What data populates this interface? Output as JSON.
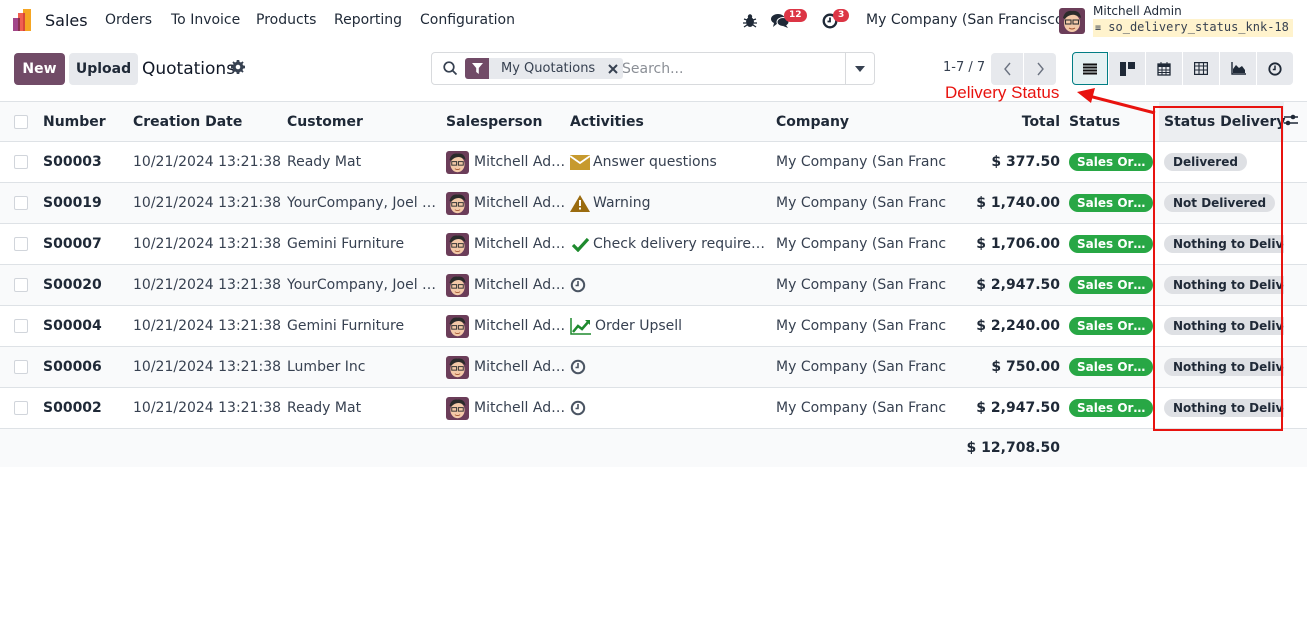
{
  "navbar": {
    "app_name": "Sales",
    "menu": [
      "Orders",
      "To Invoice",
      "Products",
      "Reporting",
      "Configuration"
    ],
    "messages_count": "12",
    "activities_count": "3",
    "company": "My Company (San Francisco)",
    "user_name": "Mitchell Admin",
    "database": "so_delivery_status_knk-18"
  },
  "control_panel": {
    "new_label": "New",
    "upload_label": "Upload",
    "title": "Quotations",
    "search": {
      "facet_label": "My Quotations",
      "placeholder": "Search..."
    },
    "pager": "1-7 / 7",
    "views": [
      "list",
      "kanban",
      "calendar",
      "pivot",
      "graph",
      "activity"
    ],
    "active_view": "list"
  },
  "annotation": {
    "label": "Delivery Status",
    "color": "#e8130f"
  },
  "table": {
    "columns": [
      "Number",
      "Creation Date",
      "Customer",
      "Salesperson",
      "Activities",
      "Company",
      "Total",
      "Status",
      "Status Delivery"
    ],
    "rows": [
      {
        "number": "S00003",
        "date": "10/21/2024 13:21:38",
        "customer": "Ready Mat",
        "salesperson": "Mitchell Ad…",
        "activity_icon": "envelope-icon",
        "activity": "Answer questions",
        "company": "My Company (San Franci…",
        "total": "$ 377.50",
        "status": "Sales Or…",
        "delivery": "Delivered"
      },
      {
        "number": "S00019",
        "date": "10/21/2024 13:21:38",
        "customer": "YourCompany, Joel …",
        "salesperson": "Mitchell Ad…",
        "activity_icon": "warning-icon",
        "activity": "Warning",
        "company": "My Company (San Franci…",
        "total": "$ 1,740.00",
        "status": "Sales Or…",
        "delivery": "Not Delivered"
      },
      {
        "number": "S00007",
        "date": "10/21/2024 13:21:38",
        "customer": "Gemini Furniture",
        "salesperson": "Mitchell Ad…",
        "activity_icon": "check-icon",
        "activity": "Check delivery requirem…",
        "company": "My Company (San Franci…",
        "total": "$ 1,706.00",
        "status": "Sales Or…",
        "delivery": "Nothing to Deliver"
      },
      {
        "number": "S00020",
        "date": "10/21/2024 13:21:38",
        "customer": "YourCompany, Joel …",
        "salesperson": "Mitchell Ad…",
        "activity_icon": "clock-icon",
        "activity": "",
        "company": "My Company (San Franci…",
        "total": "$ 2,947.50",
        "status": "Sales Or…",
        "delivery": "Nothing to Deliver"
      },
      {
        "number": "S00004",
        "date": "10/21/2024 13:21:38",
        "customer": "Gemini Furniture",
        "salesperson": "Mitchell Ad…",
        "activity_icon": "chart-up-icon",
        "activity": "Order Upsell",
        "company": "My Company (San Franci…",
        "total": "$ 2,240.00",
        "status": "Sales Or…",
        "delivery": "Nothing to Deliver"
      },
      {
        "number": "S00006",
        "date": "10/21/2024 13:21:38",
        "customer": "Lumber Inc",
        "salesperson": "Mitchell Ad…",
        "activity_icon": "clock-icon",
        "activity": "",
        "company": "My Company (San Franci…",
        "total": "$ 750.00",
        "status": "Sales Or…",
        "delivery": "Nothing to Deliver"
      },
      {
        "number": "S00002",
        "date": "10/21/2024 13:21:38",
        "customer": "Ready Mat",
        "salesperson": "Mitchell Ad…",
        "activity_icon": "clock-icon",
        "activity": "",
        "company": "My Company (San Franci…",
        "total": "$ 2,947.50",
        "status": "Sales Or…",
        "delivery": "Nothing to Deliver"
      }
    ],
    "grand_total": "$ 12,708.50"
  },
  "colors": {
    "brand": "#714b67",
    "status_green": "#28a745",
    "delivery_gray": "#dee0e4",
    "badge_red": "#dc3545",
    "active_view": "#017e84"
  }
}
